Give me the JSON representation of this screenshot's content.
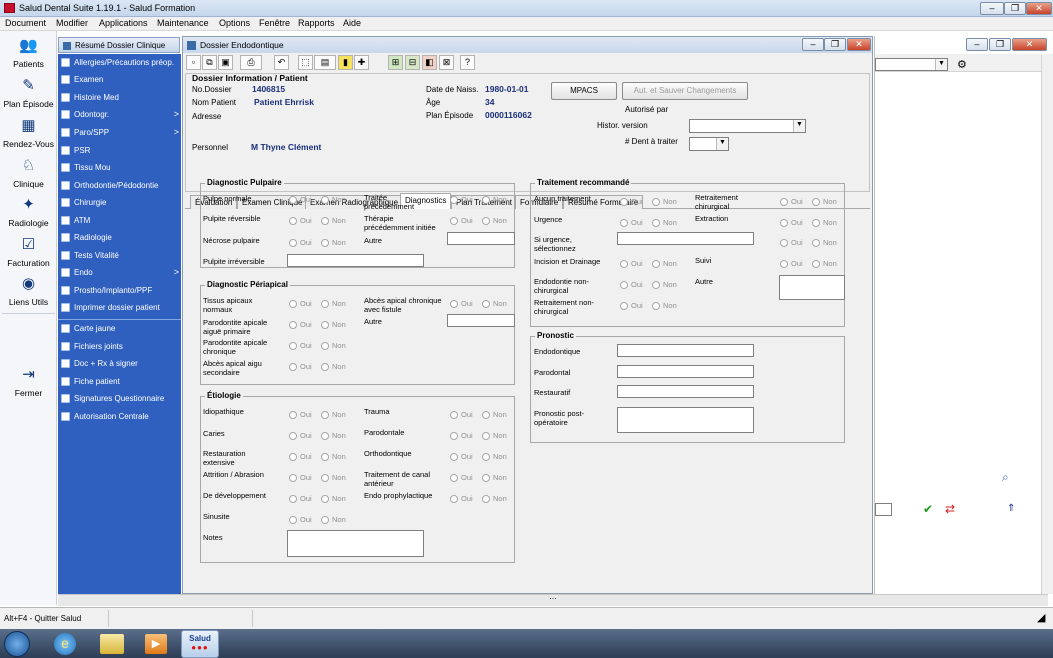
{
  "app": {
    "title": "Salud Dental Suite 1.19.1 - Salud Formation",
    "win_min": "–",
    "win_max": "❐",
    "win_close": "✕"
  },
  "menu": [
    "Document",
    "Modifier",
    "Applications",
    "Maintenance",
    "Options",
    "Fenêtre",
    "Rapports",
    "Aide"
  ],
  "leftbar": [
    {
      "label": "Patients",
      "icon": "👥"
    },
    {
      "label": "Plan Épisode",
      "icon": "✎"
    },
    {
      "label": "Rendez-Vous",
      "icon": "▦"
    },
    {
      "label": "Clinique",
      "icon": "♘"
    },
    {
      "label": "Radiologie",
      "icon": "✦"
    },
    {
      "label": "Facturation",
      "icon": "☑"
    },
    {
      "label": "Liens Utils",
      "icon": "◉"
    },
    {
      "label": "Fermer",
      "icon": "⇥"
    }
  ],
  "nav": {
    "header": "Résumé Dossier Clinique",
    "items": [
      {
        "label": "Allergies/Précautions préop.",
        "arrow": ""
      },
      {
        "label": "Examen",
        "arrow": ""
      },
      {
        "label": "Histoire Med",
        "arrow": ""
      },
      {
        "label": "Odontogr.",
        "arrow": ">"
      },
      {
        "label": "Paro/SPP",
        "arrow": ">"
      },
      {
        "label": "PSR",
        "arrow": ""
      },
      {
        "label": "Tissu Mou",
        "arrow": ""
      },
      {
        "label": "Orthodontie/Pédodontie",
        "arrow": ""
      },
      {
        "label": "Chirurgie",
        "arrow": ""
      },
      {
        "label": "ATM",
        "arrow": ""
      },
      {
        "label": "Radiologie",
        "arrow": ""
      },
      {
        "label": "Tests Vitalité",
        "arrow": ""
      },
      {
        "label": "Endo",
        "arrow": ">"
      },
      {
        "label": "Prostho/Implanto/PPF",
        "arrow": ""
      },
      {
        "label": "Imprimer dossier patient",
        "arrow": ""
      }
    ],
    "items2": [
      "Carte jaune",
      "Fichiers joints",
      "Doc + Rx à signer",
      "Fiche patient",
      "Signatures Questionnaire",
      "Autorisation Centrale"
    ]
  },
  "doc": {
    "title": "Dossier Endodontique",
    "info_title": "Dossier Information / Patient",
    "no_dossier_label": "No.Dossier",
    "no_dossier": "1406815",
    "nom_label": "Nom Patient",
    "nom": "Patient Ehrrisk",
    "adresse_label": "Adresse",
    "personnel_label": "Personnel",
    "personnel": "M Thyne Clément",
    "naiss_label": "Date de Naiss.",
    "naiss": "1980-01-01",
    "age_label": "Âge",
    "age": "34",
    "plan_label": "Plan Épisode",
    "plan": "0000116062",
    "mpacs": "MPACS",
    "aut_btn": "Aut. et Sauver Changements",
    "autorise": "Autorisé par",
    "histor": "Histor. version",
    "dent": "# Dent à traiter"
  },
  "tabs": [
    "Évaluation",
    "Examen Clinique",
    "Examen Radiographique",
    "Diagnostics",
    "Plan Traitement",
    "Formulaire",
    "Résumé Formulaire"
  ],
  "oui": "Oui",
  "non": "Non",
  "pulpaire": {
    "title": "Diagnostic Pulpaire",
    "l": [
      "Pulpe normale",
      "Pulpite réversible",
      "Nécrose pulpaire",
      "Pulpite irréversible"
    ],
    "r": [
      "Traitée précédemment",
      "Thérapie précédemment initiée",
      "Autre"
    ]
  },
  "periapical": {
    "title": "Diagnostic Périapical",
    "l": [
      "Tissus apicaux normaux",
      "Parodontite apicale aiguë primaire",
      "Parodontite apicale chronique",
      "Abcès apical aigu secondaire"
    ],
    "r": [
      "Abcès apical chronique avec fistule",
      "Autre"
    ]
  },
  "etiologie": {
    "title": "Étiologie",
    "l": [
      "Idiopathique",
      "Caries",
      "Restauration extensive",
      "Attrition / Abrasion",
      "De développement",
      "Sinusite",
      "Notes"
    ],
    "r": [
      "Trauma",
      "Parodontale",
      "Orthodontique",
      "Traitement de canal antérieur",
      "Endo prophylactique"
    ]
  },
  "traitement": {
    "title": "Traitement recommandé",
    "l": [
      "Aucun traitement",
      "Urgence",
      "Si urgence, sélectionnez",
      "Incision et Drainage",
      "Endodontie non-chirurgical",
      "Retraitement non-chirurgical"
    ],
    "r": [
      "Retraitement chirurgical",
      "Extraction",
      "Suivi",
      "Autre"
    ]
  },
  "pronostic": {
    "title": "Pronostic",
    "items": [
      "Endodontique",
      "Parodontal",
      "Restauratif",
      "Pronostic post-opératoire"
    ]
  },
  "status": {
    "text": "Alt+F4 - Quitter Salud"
  },
  "taskbar": {
    "salud": "Salud"
  }
}
